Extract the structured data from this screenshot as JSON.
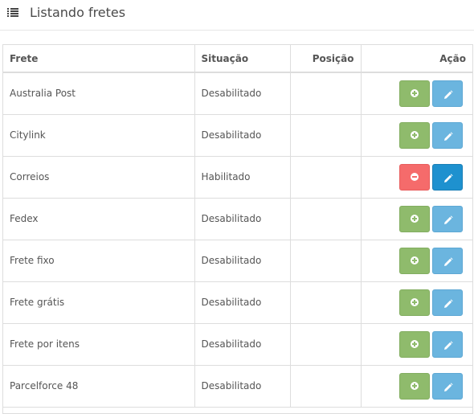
{
  "header": {
    "title": "Listando fretes",
    "icon": "list-icon"
  },
  "table": {
    "columns": [
      "Frete",
      "Situação",
      "Posição",
      "Ação"
    ],
    "rows": [
      {
        "name": "Australia Post",
        "status": "Desabilitado",
        "position": "",
        "enabled": false
      },
      {
        "name": "Citylink",
        "status": "Desabilitado",
        "position": "",
        "enabled": false
      },
      {
        "name": "Correios",
        "status": "Habilitado",
        "position": "",
        "enabled": true
      },
      {
        "name": "Fedex",
        "status": "Desabilitado",
        "position": "",
        "enabled": false
      },
      {
        "name": "Frete fixo",
        "status": "Desabilitado",
        "position": "",
        "enabled": false
      },
      {
        "name": "Frete grátis",
        "status": "Desabilitado",
        "position": "",
        "enabled": false
      },
      {
        "name": "Frete por itens",
        "status": "Desabilitado",
        "position": "",
        "enabled": false
      },
      {
        "name": "Parcelforce 48",
        "status": "Desabilitado",
        "position": "",
        "enabled": false
      }
    ]
  },
  "colors": {
    "install_green": "#8fbb6c",
    "uninstall_red": "#f56b6b",
    "edit_blue": "#6bb5df",
    "edit_blue_active": "#1e91cf"
  },
  "icons": {
    "install": "plus-circle-icon",
    "uninstall": "minus-circle-icon",
    "edit": "pencil-icon"
  }
}
